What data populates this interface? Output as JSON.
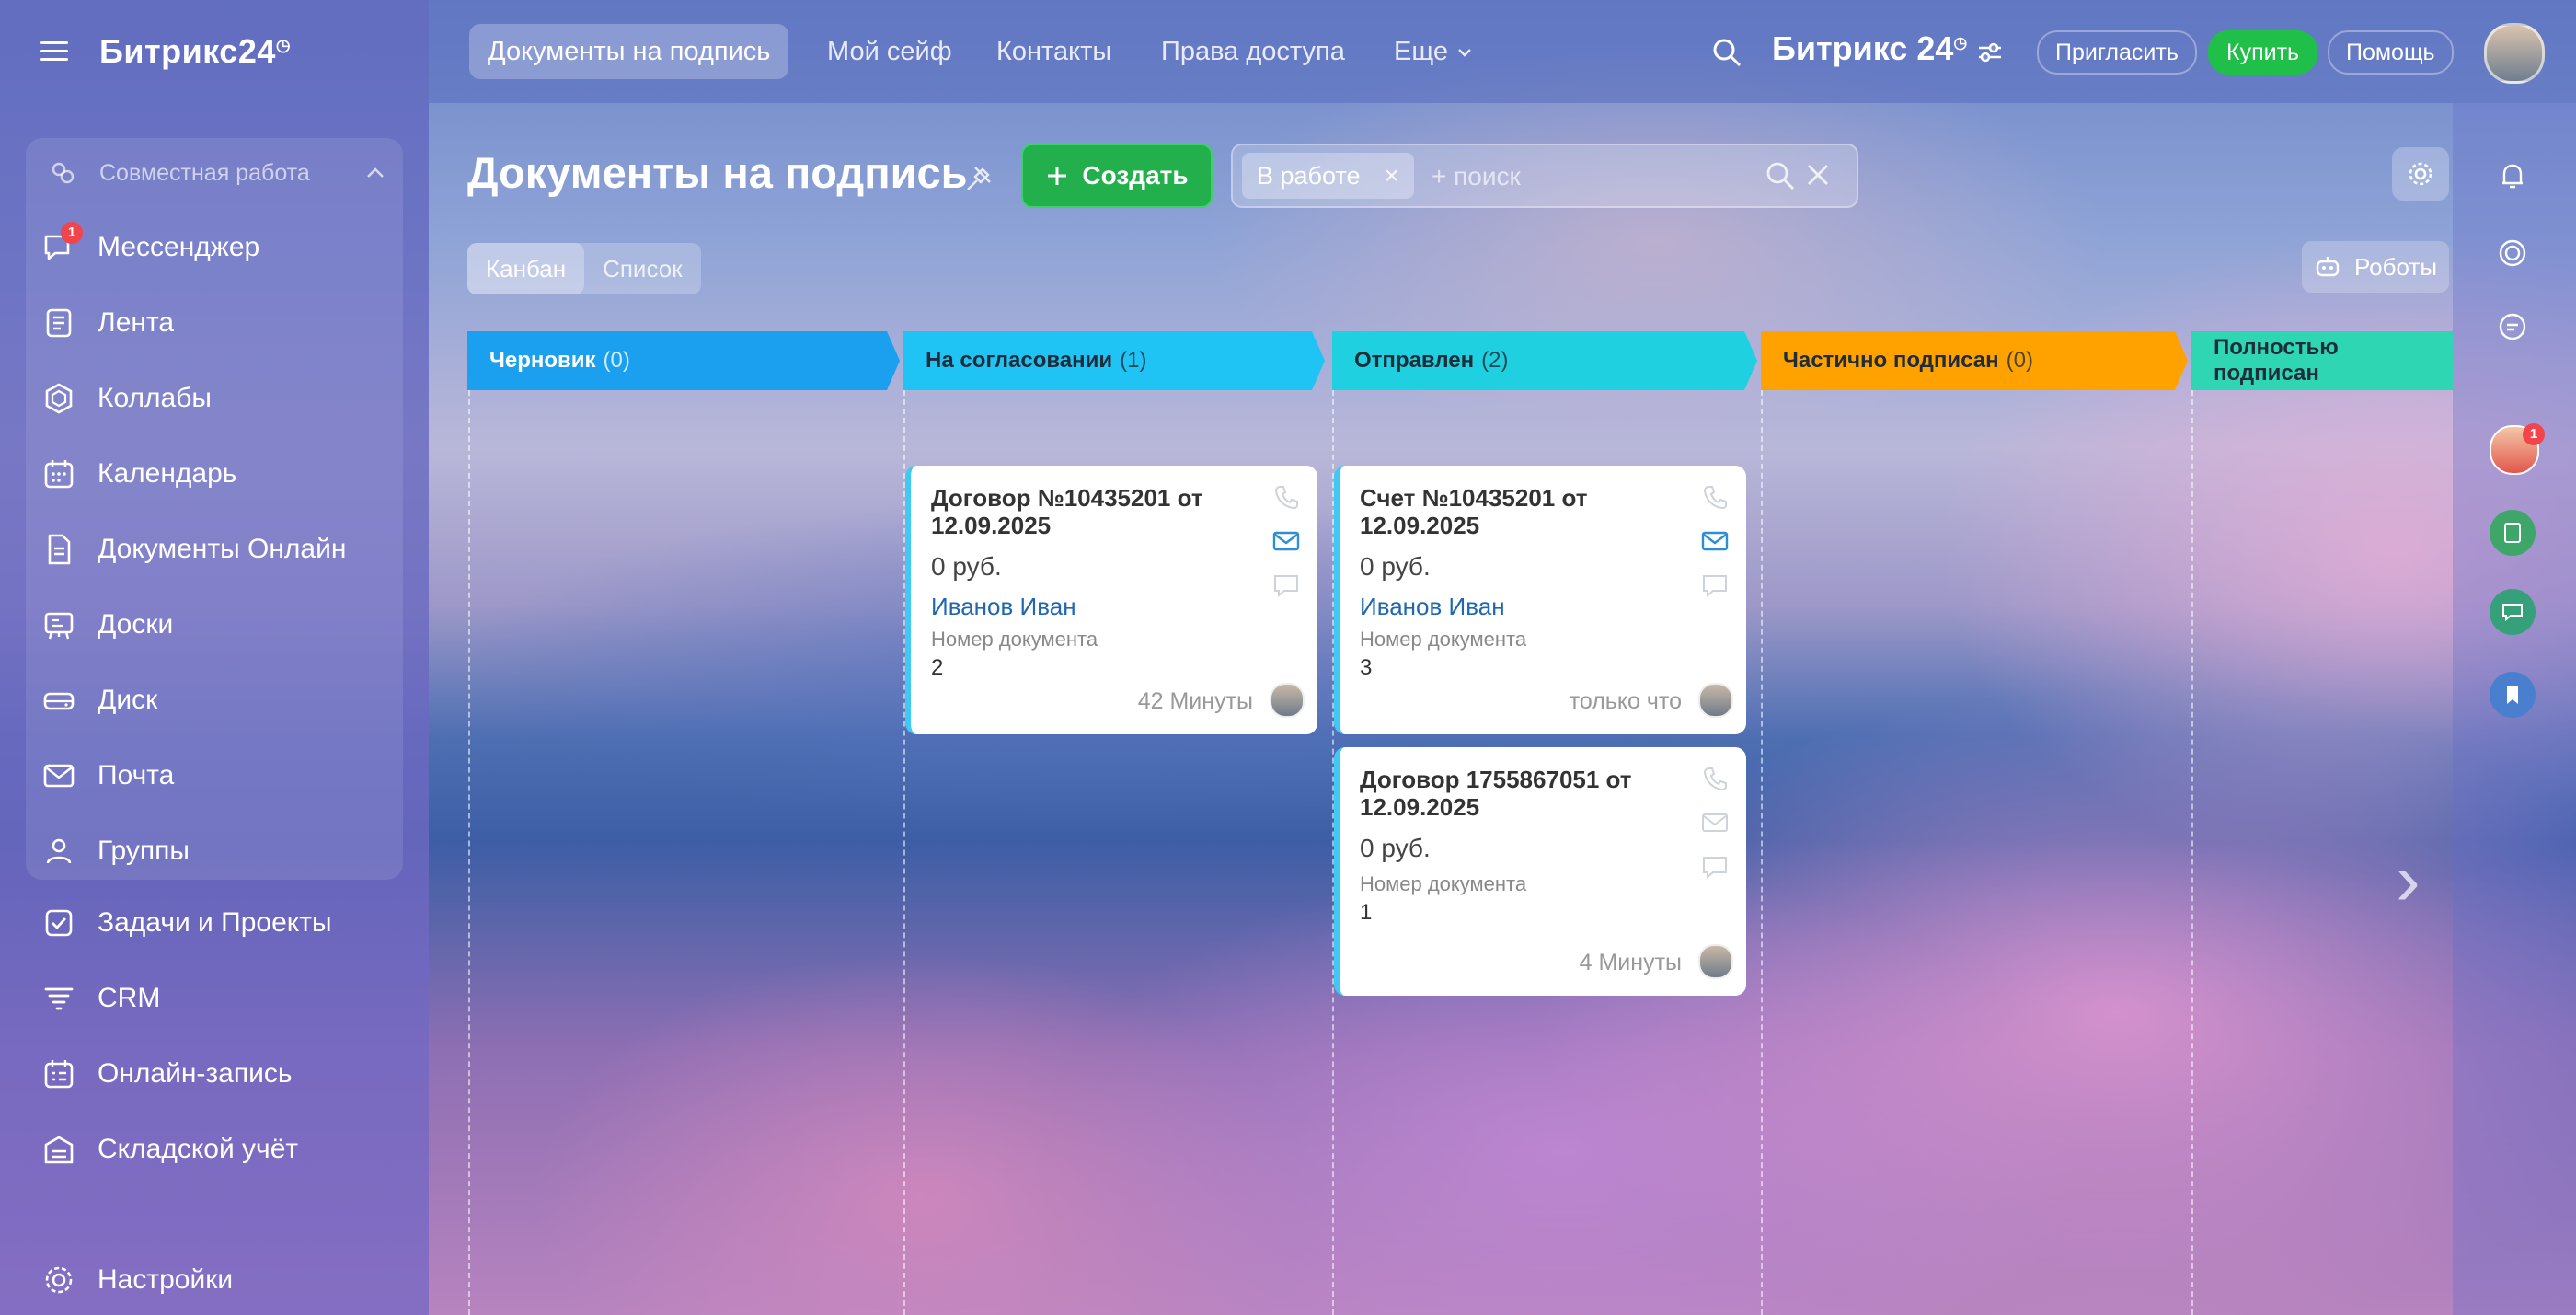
{
  "sidebar": {
    "brand": "Битрикс24",
    "brand_mark": "◷",
    "group_title": "Совместная работа",
    "items": [
      {
        "label": "Мессенджер",
        "icon": "messenger-icon",
        "badge": "1"
      },
      {
        "label": "Лента",
        "icon": "feed-icon"
      },
      {
        "label": "Коллабы",
        "icon": "collabs-icon"
      },
      {
        "label": "Календарь",
        "icon": "calendar-icon"
      },
      {
        "label": "Документы Онлайн",
        "icon": "documents-icon"
      },
      {
        "label": "Доски",
        "icon": "boards-icon"
      },
      {
        "label": "Диск",
        "icon": "disk-icon"
      },
      {
        "label": "Почта",
        "icon": "mail-icon"
      },
      {
        "label": "Группы",
        "icon": "groups-icon"
      },
      {
        "label": "Задачи и Проекты",
        "icon": "tasks-icon"
      },
      {
        "label": "CRM",
        "icon": "crm-icon"
      },
      {
        "label": "Онлайн-запись",
        "icon": "booking-icon"
      },
      {
        "label": "Складской учёт",
        "icon": "warehouse-icon"
      }
    ],
    "settings": "Настройки"
  },
  "topbar": {
    "tabs": [
      "Документы на подпись",
      "Мой сейф",
      "Контакты",
      "Права доступа",
      "Еще"
    ],
    "brand": "Битрикс 24",
    "invite": "Пригласить",
    "buy": "Купить",
    "help": "Помощь"
  },
  "page": {
    "title": "Документы на подпись",
    "create": "Создать",
    "filter_chip": "В работе",
    "search_placeholder": "+ поиск",
    "view_kanban": "Канбан",
    "view_list": "Список",
    "robots": "Роботы"
  },
  "stages": [
    {
      "name": "Черновик",
      "count": "(0)",
      "color": "#1aa0ef"
    },
    {
      "name": "На согласовании",
      "count": "(1)",
      "color": "#20c4f4"
    },
    {
      "name": "Отправлен",
      "count": "(2)",
      "color": "#1ed0e0"
    },
    {
      "name": "Частично подписан",
      "count": "(0)",
      "color": "#ffa200"
    },
    {
      "name": "Полностью подписан",
      "count": "",
      "color": "#2fd6b4"
    }
  ],
  "cards": [
    {
      "title": "Договор №10435201 от 12.09.2025",
      "sum": "0 руб.",
      "client": "Иванов Иван",
      "field_label": "Номер документа",
      "field_value": "2",
      "time": "42 Минуты"
    },
    {
      "title": "Счет №10435201 от 12.09.2025",
      "sum": "0 руб.",
      "client": "Иванов Иван",
      "field_label": "Номер документа",
      "field_value": "3",
      "time": "только что"
    },
    {
      "title": "Договор 1755867051 от 12.09.2025",
      "sum": "0 руб.",
      "client": "",
      "field_label": "Номер документа",
      "field_value": "1",
      "time": "4 Минуты"
    }
  ],
  "right_panel": {
    "avatar_badge": "1"
  },
  "colors": {
    "accent_green": "#1fbf4a",
    "link_blue": "#2067b0"
  }
}
